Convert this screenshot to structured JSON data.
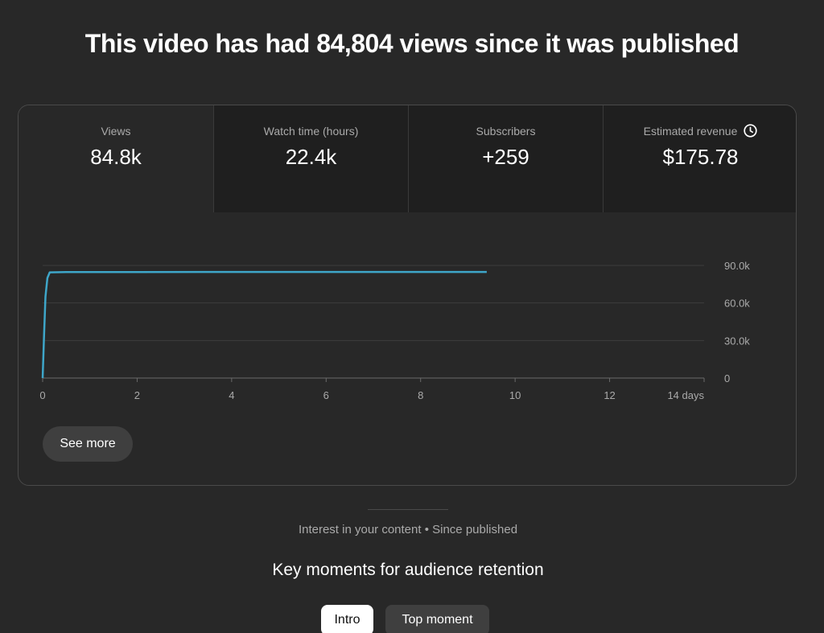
{
  "headline": "This video has had 84,804 views since it was published",
  "metrics": [
    {
      "label": "Views",
      "value": "84.8k"
    },
    {
      "label": "Watch time (hours)",
      "value": "22.4k"
    },
    {
      "label": "Subscribers",
      "value": "+259"
    },
    {
      "label": "Estimated revenue",
      "value": "$175.78",
      "icon": "clock-icon"
    }
  ],
  "chart_data": {
    "type": "line",
    "x_tick_labels": [
      "0",
      "2",
      "4",
      "6",
      "8",
      "10",
      "12",
      "14 days"
    ],
    "y_tick_labels": [
      "90.0k",
      "60.0k",
      "30.0k",
      "0"
    ],
    "xlim": [
      0,
      14
    ],
    "ylim": [
      0,
      90000
    ],
    "series": [
      {
        "color": "#3ea6c9",
        "x": [
          0,
          0.03,
          0.06,
          0.1,
          0.15,
          0.5,
          2,
          4,
          6,
          8,
          9.4
        ],
        "y": [
          0,
          35000,
          65000,
          80000,
          84500,
          84700,
          84750,
          84770,
          84790,
          84800,
          84804
        ]
      }
    ],
    "grid": true
  },
  "see_more_label": "See more",
  "interest_caption": "Interest in your content • Since published",
  "retention_title": "Key moments for audience retention",
  "chips": [
    {
      "label": "Intro",
      "selected": true
    },
    {
      "label": "Top moment",
      "selected": false
    }
  ],
  "colors": {
    "background": "#282828",
    "line": "#3ea6c9",
    "selected_chip": "#ffffff"
  }
}
